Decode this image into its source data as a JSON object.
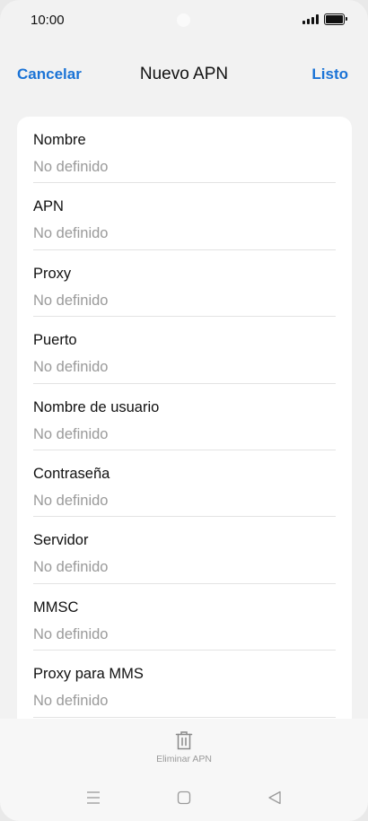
{
  "status_bar": {
    "time": "10:00",
    "icons": [
      "signal-icon",
      "battery-icon"
    ]
  },
  "header": {
    "cancel_label": "Cancelar",
    "title": "Nuevo APN",
    "done_label": "Listo"
  },
  "fields": [
    {
      "label": "Nombre",
      "value": "No definido"
    },
    {
      "label": "APN",
      "value": "No definido"
    },
    {
      "label": "Proxy",
      "value": "No definido"
    },
    {
      "label": "Puerto",
      "value": "No definido"
    },
    {
      "label": "Nombre de usuario",
      "value": "No definido"
    },
    {
      "label": "Contraseña",
      "value": "No definido"
    },
    {
      "label": "Servidor",
      "value": "No definido"
    },
    {
      "label": "MMSC",
      "value": "No definido"
    },
    {
      "label": "Proxy para MMS",
      "value": "No definido"
    }
  ],
  "bottom_bar": {
    "delete_label": "Eliminar APN",
    "icon": "trash-icon"
  },
  "nav_bar": {
    "icons": [
      "menu-icon",
      "home-icon",
      "back-icon"
    ]
  },
  "colors": {
    "accent": "#1a73d6",
    "background": "#f2f2f2",
    "card": "#ffffff",
    "secondary_text": "#9a9a9a"
  }
}
